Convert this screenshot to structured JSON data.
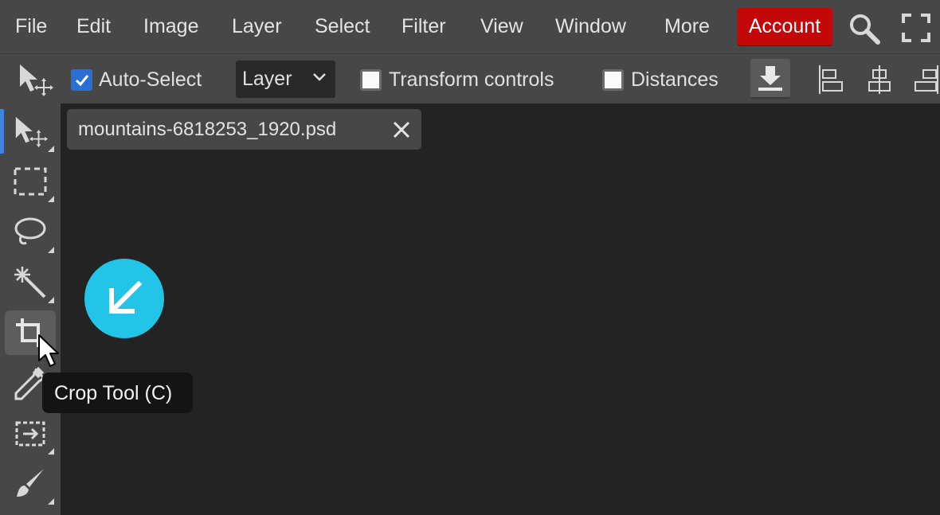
{
  "menubar": {
    "items": [
      "File",
      "Edit",
      "Image",
      "Layer",
      "Select",
      "Filter",
      "View",
      "Window",
      "More"
    ],
    "account_label": "Account",
    "search_icon": "search-icon",
    "fullscreen_icon": "fullscreen-icon"
  },
  "options": {
    "auto_select_label": "Auto-Select",
    "auto_select_checked": true,
    "layer_select_value": "Layer",
    "transform_controls_label": "Transform controls",
    "transform_controls_checked": false,
    "distances_label": "Distances",
    "distances_checked": false
  },
  "toolbar": {
    "tools": [
      {
        "name": "move-tool",
        "icon": "move-icon"
      },
      {
        "name": "marquee-tool",
        "icon": "marquee-icon"
      },
      {
        "name": "lasso-tool",
        "icon": "lasso-icon"
      },
      {
        "name": "magic-wand-tool",
        "icon": "magic-wand-icon"
      },
      {
        "name": "crop-tool",
        "icon": "crop-icon"
      },
      {
        "name": "eyedropper-tool",
        "icon": "eyedropper-icon"
      },
      {
        "name": "transform-tool",
        "icon": "transform-icon"
      },
      {
        "name": "brush-tool",
        "icon": "brush-icon"
      }
    ]
  },
  "document": {
    "tab_name": "mountains-6818253_1920.psd"
  },
  "tooltip": {
    "text": "Crop Tool (C)"
  },
  "colors": {
    "accent": "#3f83e6",
    "account_red": "#c4080a",
    "hint_cyan": "#22c4e8",
    "panel_bg": "#474747",
    "canvas_bg": "#232323"
  }
}
